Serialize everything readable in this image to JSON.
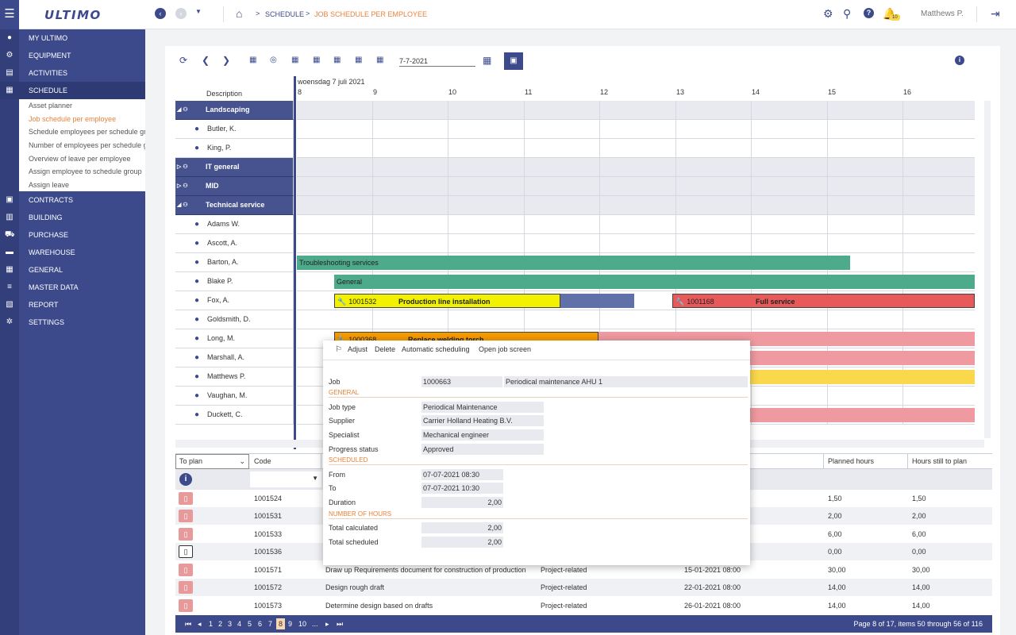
{
  "app": {
    "logo": "ULTIMO",
    "user": "Matthews P.",
    "notifications": "10"
  },
  "breadcrumb": {
    "level1": "SCHEDULE",
    "level2": "JOB SCHEDULE PER EMPLOYEE"
  },
  "sidebar": {
    "items": [
      {
        "label": "MY ULTIMO",
        "icon": "person-icon"
      },
      {
        "label": "EQUIPMENT",
        "icon": "gear-icon"
      },
      {
        "label": "ACTIVITIES",
        "icon": "activities-icon"
      },
      {
        "label": "SCHEDULE",
        "icon": "calendar-icon"
      },
      {
        "label": "CONTRACTS",
        "icon": "contract-icon"
      },
      {
        "label": "BUILDING",
        "icon": "building-icon"
      },
      {
        "label": "PURCHASE",
        "icon": "cart-icon"
      },
      {
        "label": "WAREHOUSE",
        "icon": "warehouse-icon"
      },
      {
        "label": "GENERAL",
        "icon": "grid-icon"
      },
      {
        "label": "MASTER DATA",
        "icon": "database-icon"
      },
      {
        "label": "REPORT",
        "icon": "report-icon"
      },
      {
        "label": "SETTINGS",
        "icon": "wrench-gear-icon"
      }
    ],
    "schedule_sub": [
      "Asset planner",
      "Job schedule per employee",
      "Schedule employees per schedule group",
      "Number of employees per schedule group",
      "Overview of leave per employee",
      "Assign employee to schedule group",
      "Assign leave"
    ]
  },
  "toolbar": {
    "date_value": "7-7-2021"
  },
  "gantt": {
    "description_header": "Description",
    "date_header": "woensdag 7 juli 2021",
    "hours": [
      "8",
      "9",
      "10",
      "11",
      "12",
      "13",
      "14",
      "15",
      "16"
    ],
    "rows": [
      {
        "label": "Landscaping",
        "group": true,
        "expanded": true
      },
      {
        "label": "Butler, K.",
        "group": false
      },
      {
        "label": "King, P.",
        "group": false
      },
      {
        "label": "IT general",
        "group": true,
        "expanded": false
      },
      {
        "label": "MID",
        "group": true,
        "expanded": false
      },
      {
        "label": "Technical service",
        "group": true,
        "expanded": true
      },
      {
        "label": "Adams W.",
        "group": false
      },
      {
        "label": "Ascott, A.",
        "group": false
      },
      {
        "label": "Barton, A.",
        "group": false
      },
      {
        "label": "Blake P.",
        "group": false
      },
      {
        "label": "Fox, A.",
        "group": false
      },
      {
        "label": "Goldsmith, D.",
        "group": false
      },
      {
        "label": "Long, M.",
        "group": false
      },
      {
        "label": "Marshall, A.",
        "group": false
      },
      {
        "label": "Matthews P.",
        "group": false
      },
      {
        "label": "Vaughan, M.",
        "group": false
      },
      {
        "label": "Duckett, C.",
        "group": false
      }
    ],
    "bars": [
      {
        "text": "Troubleshooting services",
        "code": ""
      },
      {
        "text": "General",
        "code": ""
      },
      {
        "text": "Production line installation",
        "code": "1001532"
      },
      {
        "text": "Full service",
        "code": "1001168"
      },
      {
        "text": "Replace welding torch",
        "code": "1000368"
      }
    ]
  },
  "table": {
    "filter_select": "To plan",
    "headers": {
      "code": "Code",
      "planned": "Planned hours",
      "still": "Hours still to plan"
    },
    "rows": [
      {
        "code": "1001524",
        "desc": "",
        "type": "",
        "date": "",
        "planned": "1,50",
        "still": "1,50"
      },
      {
        "code": "1001531",
        "desc": "",
        "type": "",
        "date": "",
        "planned": "2,00",
        "still": "2,00"
      },
      {
        "code": "1001533",
        "desc": "",
        "type": "",
        "date": "",
        "planned": "6,00",
        "still": "6,00"
      },
      {
        "code": "1001536",
        "desc": "",
        "type": "",
        "date": "",
        "planned": "0,00",
        "still": "0,00"
      },
      {
        "code": "1001571",
        "desc": "Draw up Requirements document for construction of production",
        "type": "Project-related",
        "date": "15-01-2021 08:00",
        "planned": "30,00",
        "still": "30,00"
      },
      {
        "code": "1001572",
        "desc": "Design rough draft",
        "type": "Project-related",
        "date": "22-01-2021 08:00",
        "planned": "14,00",
        "still": "14,00"
      },
      {
        "code": "1001573",
        "desc": "Determine design based on drafts",
        "type": "Project-related",
        "date": "26-01-2021 08:00",
        "planned": "14,00",
        "still": "14,00"
      }
    ]
  },
  "pager": {
    "pages": [
      "1",
      "2",
      "3",
      "4",
      "5",
      "6",
      "7",
      "8",
      "9",
      "10",
      "..."
    ],
    "current": "8",
    "info": "Page 8 of 17, items 50 through 56 of 116"
  },
  "popup": {
    "actions": {
      "adjust": "Adjust",
      "delete": "Delete",
      "auto": "Automatic scheduling",
      "open": "Open job screen"
    },
    "job_label": "Job",
    "job_code": "1000663",
    "job_desc": "Periodical maintenance AHU 1",
    "sec_general": "GENERAL",
    "job_type_label": "Job type",
    "job_type": "Periodical Maintenance",
    "supplier_label": "Supplier",
    "supplier": "Carrier Holland Heating B.V.",
    "specialist_label": "Specialist",
    "specialist": "Mechanical engineer",
    "progress_label": "Progress status",
    "progress": "Approved",
    "sec_scheduled": "SCHEDULED",
    "from_label": "From",
    "from": "07-07-2021 08:30",
    "to_label": "To",
    "to": "07-07-2021 10:30",
    "duration_label": "Duration",
    "duration": "2,00",
    "sec_hours": "NUMBER OF HOURS",
    "total_calc_label": "Total calculated",
    "total_calc": "2,00",
    "total_sched_label": "Total scheduled",
    "total_sched": "2,00"
  },
  "colors": {
    "primary": "#3c4a8c",
    "accent": "#e8823a",
    "green": "#4daa8a",
    "yellow": "#f2f200",
    "red": "#e85a5a",
    "orange": "#f59a00",
    "pink": "#ee9aa0",
    "gold": "#fad84c"
  }
}
